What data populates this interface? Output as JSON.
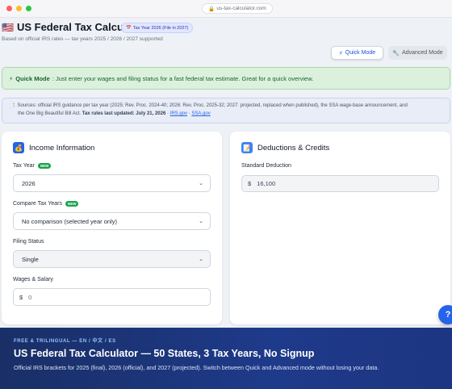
{
  "browser": {
    "url": "us-tax-calculator.com"
  },
  "header": {
    "flag": "🇺🇸",
    "title": "US Federal Tax Calculator",
    "year_badge": "Tax Year 2026 (File in 2027)",
    "subtitle": "Based on official IRS rates — tax years 2025 / 2026 / 2027 supported"
  },
  "modes": {
    "quick_label": "Quick Mode",
    "advanced_label": "Advanced Mode",
    "active": "quick"
  },
  "banner": {
    "bold": "Quick Mode",
    "text": ": Just enter your wages and filing status for a fast federal tax estimate. Great for a quick overview."
  },
  "sources": {
    "line1": "Sources: official IRS guidance per tax year (2025: Rev. Proc. 2024-40; 2026: Rev. Proc. 2025-32; 2027: projected, replaced when published), the SSA wage-base announcement, and",
    "line2": "the One Big Beautiful Bill Act.",
    "updated": "Tax rules last updated: July 21, 2026",
    "sep": "·",
    "link1": "IRS.gov",
    "link2": "SSA.gov"
  },
  "income": {
    "title": "Income Information",
    "tax_year_label": "Tax Year",
    "tax_year_value": "2026",
    "compare_label": "Compare Tax Years",
    "compare_value": "No comparison (selected year only)",
    "filing_label": "Filing Status",
    "filing_value": "Single",
    "wages_label": "Wages & Salary",
    "wages_value": "0",
    "new_badge": "NEW"
  },
  "deductions": {
    "title": "Deductions & Credits",
    "standard_label": "Standard Deduction",
    "standard_value": "16,100"
  },
  "currency_symbol": "$",
  "help_button": "?",
  "promo": {
    "eyebrow": "FREE & TRILINGUAL — EN / 中文 / ES",
    "title": "US Federal Tax Calculator — 50 States, 3 Tax Years, No Signup",
    "description": "Official IRS brackets for 2025 (final), 2026 (official), and 2027 (projected). Switch between Quick and Advanced mode without losing your data."
  },
  "icons": {
    "lock": "lock-icon",
    "calendar": "calendar-icon",
    "bolt": "lightning-icon",
    "wrench": "wrench-icon",
    "document": "document-icon",
    "money_bag": "money-bag-icon",
    "memo": "memo-icon",
    "chevron": "chevron-down-icon"
  },
  "colors": {
    "accent": "#2563eb",
    "success_bg": "#dcf1dc",
    "new_badge": "#16a34a",
    "promo_bg": "#1e3a8a"
  }
}
